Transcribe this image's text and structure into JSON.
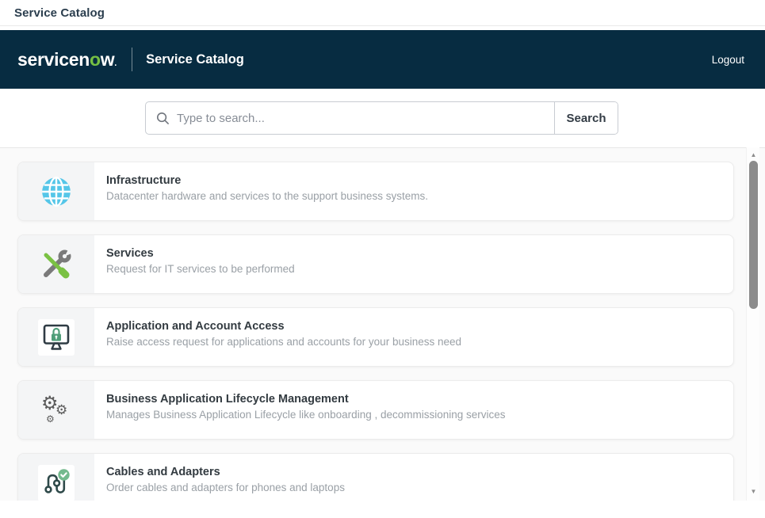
{
  "page": {
    "title": "Service Catalog"
  },
  "header": {
    "logo": {
      "part1": "servicen",
      "o": "o",
      "part2": "w",
      "dot": "."
    },
    "app_title": "Service Catalog",
    "logout_label": "Logout"
  },
  "search": {
    "placeholder": "Type to search...",
    "value": "",
    "button_label": "Search",
    "icon": "search-icon"
  },
  "catalog": {
    "items": [
      {
        "icon": "globe-icon",
        "title": "Infrastructure",
        "description": "Datacenter hardware and services to the support business systems."
      },
      {
        "icon": "tools-icon",
        "title": "Services",
        "description": "Request for IT services to be performed"
      },
      {
        "icon": "monitor-lock-icon",
        "title": "Application and Account Access",
        "description": "Raise access request for applications and accounts for your business need"
      },
      {
        "icon": "gears-icon",
        "title": "Business Application Lifecycle Management",
        "description": "Manages Business Application Lifecycle like onboarding , decommissioning services"
      },
      {
        "icon": "cable-check-icon",
        "title": "Cables and Adapters",
        "description": "Order cables and adapters for phones and laptops"
      }
    ]
  },
  "scrollbar": {
    "up_glyph": "▲",
    "down_glyph": "▼"
  },
  "colors": {
    "header_navy": "#072c41",
    "brand_green": "#76c043",
    "globe_blue": "#55c6e8",
    "tool_green": "#7ac143",
    "tool_gray": "#7a7a7a",
    "lock_green": "#4f9e79",
    "badge_green": "#74ba8e",
    "title_text": "#333b41",
    "desc_text": "#9aa0a6",
    "content_bg": "#fafafa"
  },
  "gears": {
    "glyph": "⚙"
  }
}
